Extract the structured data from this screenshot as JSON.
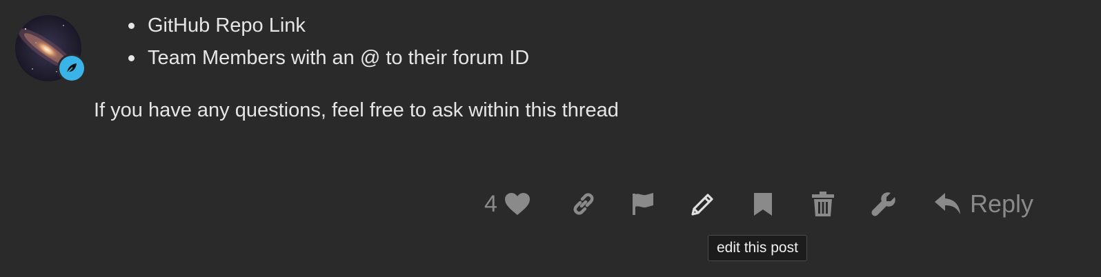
{
  "post": {
    "list_items": [
      "GitHub Repo Link",
      "Team Members with an @ to their forum ID"
    ],
    "paragraph": "If you have any questions, feel free to ask within this thread"
  },
  "avatar": {
    "badge_icon": "leaf-icon",
    "badge_color": "#3ab4e8"
  },
  "actions": {
    "like_count": "4",
    "reply_label": "Reply",
    "icons": [
      "heart-icon",
      "link-icon",
      "flag-icon",
      "pencil-icon",
      "bookmark-icon",
      "trash-icon",
      "wrench-icon",
      "reply-arrow-icon"
    ],
    "icon_color": "#8a8a8a",
    "active_icon_color": "#e0e0e0"
  },
  "tooltip": {
    "text": "edit this post"
  }
}
